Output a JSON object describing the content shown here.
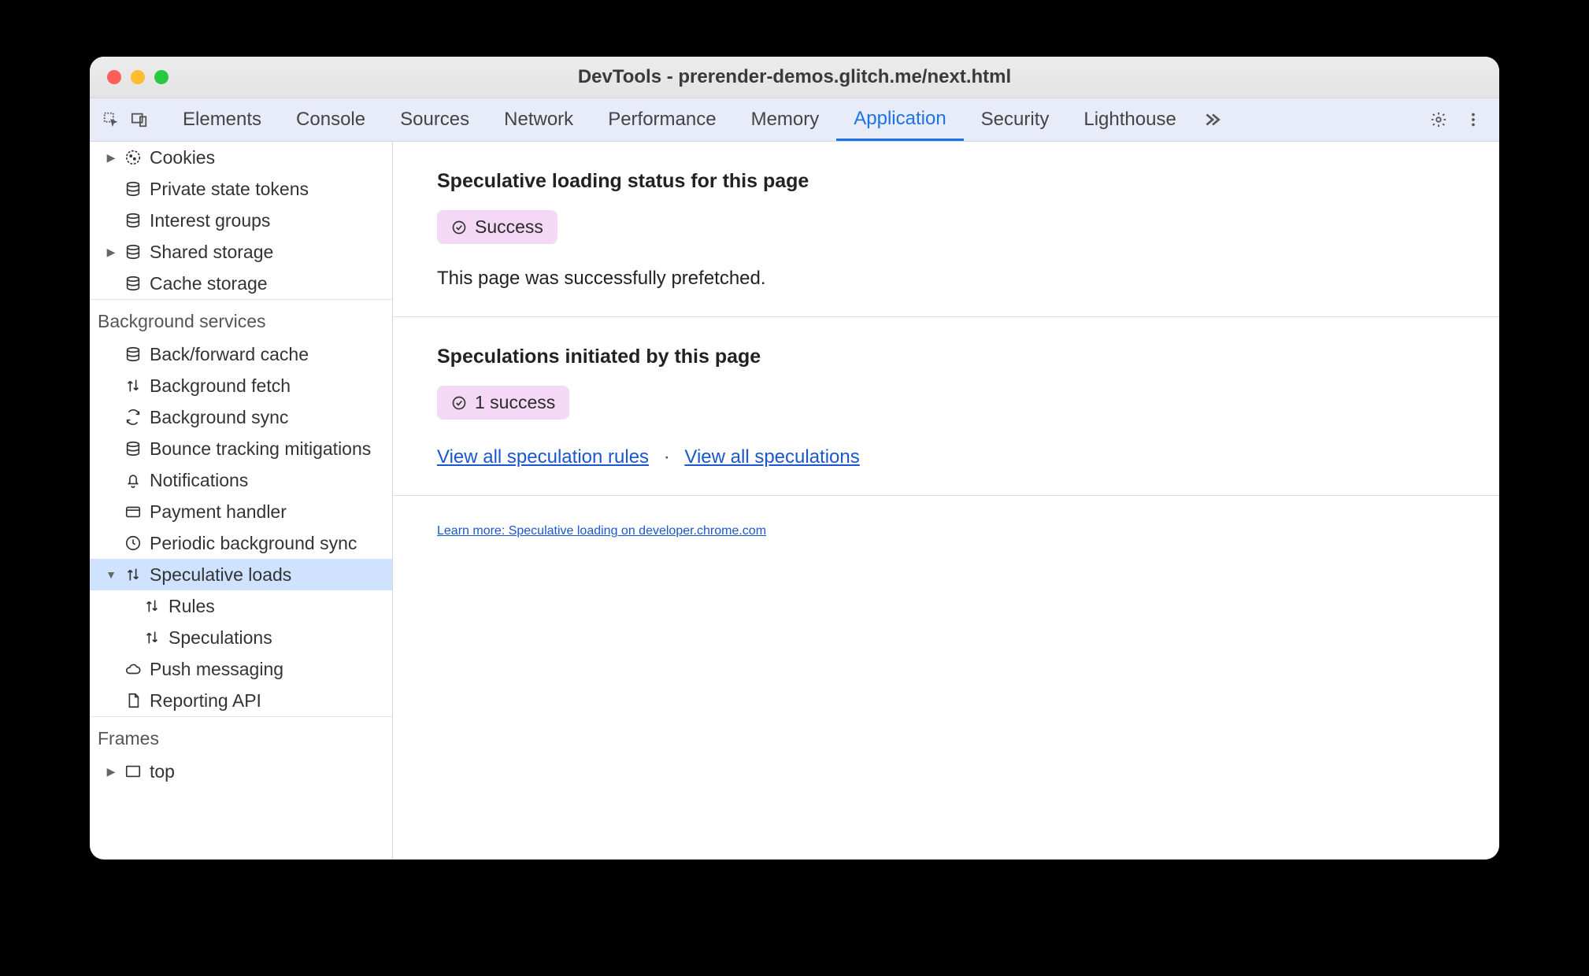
{
  "window": {
    "title": "DevTools - prerender-demos.glitch.me/next.html"
  },
  "tabs": [
    {
      "label": "Elements",
      "active": false
    },
    {
      "label": "Console",
      "active": false
    },
    {
      "label": "Sources",
      "active": false
    },
    {
      "label": "Network",
      "active": false
    },
    {
      "label": "Performance",
      "active": false
    },
    {
      "label": "Memory",
      "active": false
    },
    {
      "label": "Application",
      "active": true
    },
    {
      "label": "Security",
      "active": false
    },
    {
      "label": "Lighthouse",
      "active": false
    }
  ],
  "sidebar": {
    "storage": [
      {
        "label": "Cookies",
        "icon": "cookie",
        "expandable": true
      },
      {
        "label": "Private state tokens",
        "icon": "db"
      },
      {
        "label": "Interest groups",
        "icon": "db"
      },
      {
        "label": "Shared storage",
        "icon": "db",
        "expandable": true
      },
      {
        "label": "Cache storage",
        "icon": "db"
      }
    ],
    "bg_header": "Background services",
    "bg": [
      {
        "label": "Back/forward cache",
        "icon": "db"
      },
      {
        "label": "Background fetch",
        "icon": "updown"
      },
      {
        "label": "Background sync",
        "icon": "sync"
      },
      {
        "label": "Bounce tracking mitigations",
        "icon": "db"
      },
      {
        "label": "Notifications",
        "icon": "bell"
      },
      {
        "label": "Payment handler",
        "icon": "card"
      },
      {
        "label": "Periodic background sync",
        "icon": "clock"
      },
      {
        "label": "Speculative loads",
        "icon": "updown",
        "expandable": true,
        "expanded": true,
        "selected": true
      },
      {
        "label": "Rules",
        "icon": "updown",
        "child": true
      },
      {
        "label": "Speculations",
        "icon": "updown",
        "child": true
      },
      {
        "label": "Push messaging",
        "icon": "cloud"
      },
      {
        "label": "Reporting API",
        "icon": "doc"
      }
    ],
    "frames_header": "Frames",
    "frames": [
      {
        "label": "top",
        "icon": "frame",
        "expandable": true
      }
    ]
  },
  "main": {
    "status_heading": "Speculative loading status for this page",
    "status_badge": "Success",
    "status_desc": "This page was successfully prefetched.",
    "spec_heading": "Speculations initiated by this page",
    "spec_badge": "1 success",
    "link_rules": "View all speculation rules",
    "link_specs": "View all speculations",
    "learn_more": "Learn more: Speculative loading on developer.chrome.com"
  }
}
